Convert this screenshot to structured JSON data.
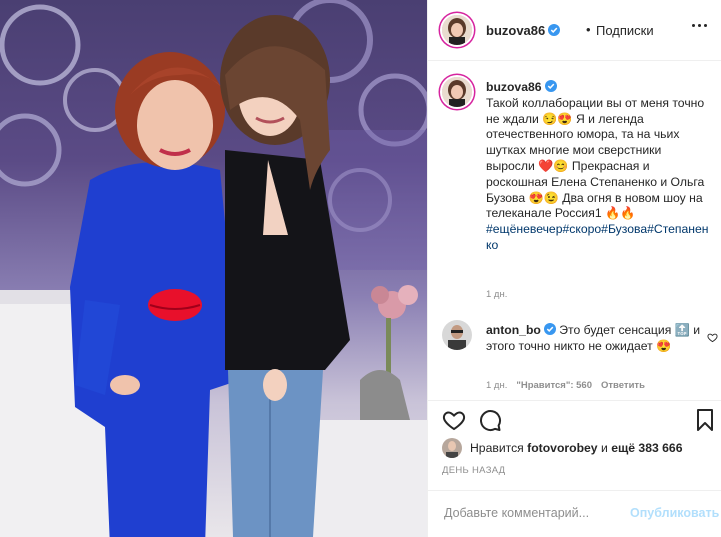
{
  "post": {
    "username": "buzova86",
    "follow_separator": "•",
    "follow_label": "Подписки"
  },
  "caption": {
    "username": "buzova86",
    "text": "Такой коллаборации вы от меня точно не ждали 😏😍 Я и легенда отечественного юмора, та на чьих шутках многие мои сверстники выросли ❤️😊 Прекрасная и роскошная Елена Степаненко и Ольга Бузова 😍😉 Два огня в новом шоу на телеканале Россия1 🔥🔥",
    "hashtags": "#ещёневечер#скоро#Бузова#Степаненко",
    "time": "1 дн."
  },
  "comment": {
    "username": "anton_bo",
    "text": "Это будет сенсация 🔝 и этого точно никто не ожидает 😍",
    "time": "1 дн.",
    "likes": "\"Нравится\": 560",
    "reply": "Ответить"
  },
  "likes": {
    "prefix": "Нравится",
    "user": "fotovorobey",
    "middle": "и",
    "count": "ещё 383 666"
  },
  "date": "ДЕНЬ НАЗАД",
  "add_comment": {
    "placeholder": "Добавьте комментарий...",
    "post_label": "Опубликовать"
  },
  "colors": {
    "accent_link": "#00376b",
    "verified": "#3897f0",
    "post_disabled": "#b2dffc",
    "text": "#262626",
    "muted": "#8e8e8e"
  },
  "icons": [
    "more-icon",
    "verified-icon",
    "heart-icon",
    "comment-icon",
    "bookmark-icon",
    "comment-like-icon"
  ]
}
